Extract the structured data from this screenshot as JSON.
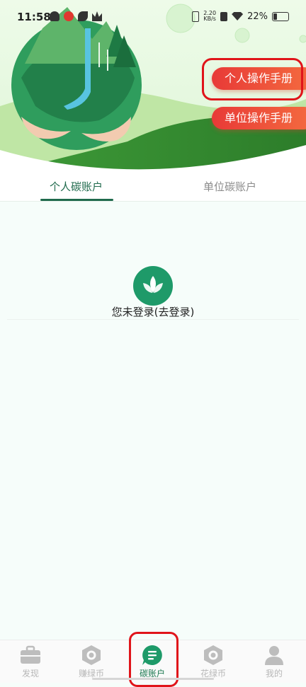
{
  "status_bar": {
    "time": "11:58",
    "net_speed_value": "2.20",
    "net_speed_unit": "KB/s",
    "battery": "22%"
  },
  "header": {
    "personal_manual_button": "个人操作手册",
    "unit_manual_button": "单位操作手册"
  },
  "tabs": [
    {
      "label": "个人碳账户",
      "active": true
    },
    {
      "label": "单位碳账户",
      "active": false
    }
  ],
  "login_prompt": "您未登录(去登录)",
  "bottom_nav": [
    {
      "label": "发现",
      "icon": "briefcase-icon",
      "active": false
    },
    {
      "label": "赚绿币",
      "icon": "hexagon-coin-icon",
      "active": false
    },
    {
      "label": "碳账户",
      "icon": "chat-list-icon",
      "active": true
    },
    {
      "label": "花绿币",
      "icon": "hexagon-coin-icon",
      "active": false
    },
    {
      "label": "我的",
      "icon": "user-icon",
      "active": false
    }
  ],
  "colors": {
    "brand_green": "#1e9a69",
    "accent_red": "#e83a37",
    "active_tab": "#1f6a4c"
  }
}
